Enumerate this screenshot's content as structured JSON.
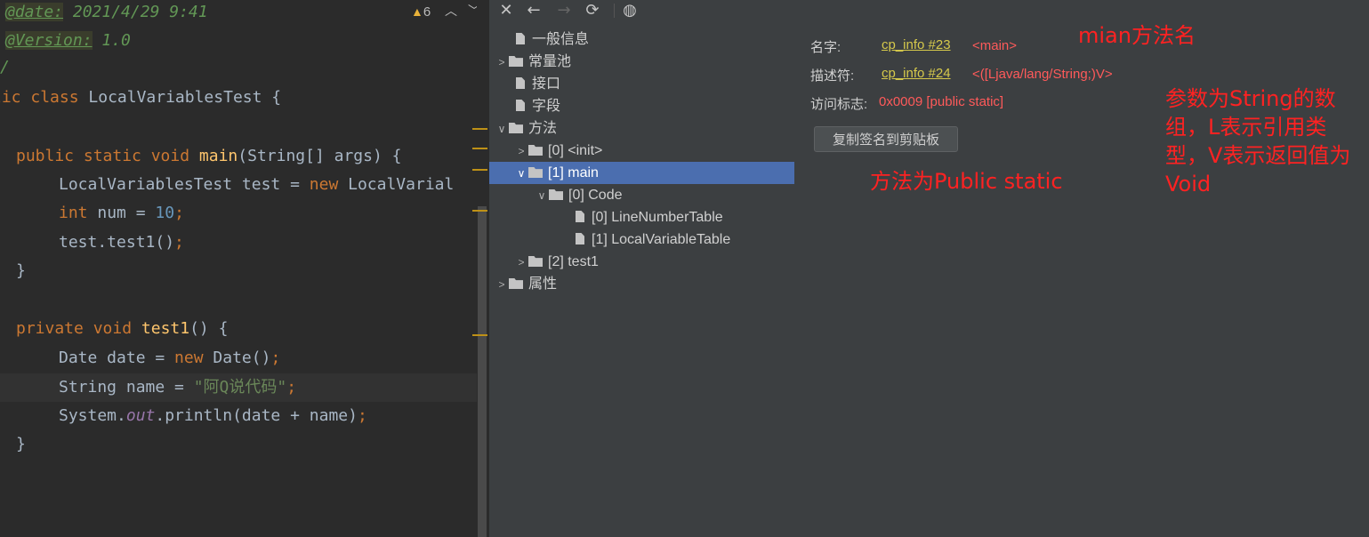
{
  "editor": {
    "warnings": {
      "icon": "warning-icon",
      "count": "6"
    },
    "lines": {
      "l1": {
        "tag": "@date:",
        "rest": " 2021/4/29 9:41"
      },
      "l2": {
        "tag": "@Version:",
        "rest": " 1.0"
      },
      "l3": {
        "text": "/"
      },
      "l4": {
        "kw1": "lic ",
        "kw2": "class ",
        "name": "LocalVariablesTest {"
      },
      "l5": {
        "kw1": "public ",
        "kw2": "static ",
        "kw3": "void ",
        "fn": "main",
        "rest": "(String[] args) {"
      },
      "l6": {
        "a": "LocalVariablesTest test = ",
        "kw": "new ",
        "b": "LocalVarial"
      },
      "l7": {
        "kw": "int ",
        "a": "num = ",
        "num": "10",
        "semi": ";"
      },
      "l8": {
        "a": "test.test1()",
        "semi": ";"
      },
      "l9": {
        "a": "}"
      },
      "l10": {
        "kw1": "private ",
        "kw2": "void ",
        "fn": "test1",
        "rest": "() {"
      },
      "l11": {
        "a": "Date date = ",
        "kw": "new ",
        "b": "Date()",
        "semi": ";"
      },
      "l12": {
        "a": "String name = ",
        "str": "\"阿Q说代码\"",
        "semi": ";"
      },
      "l13": {
        "a": "System.",
        "field": "out",
        "b": ".println(date + name)",
        "semi": ";"
      },
      "l14": {
        "a": "}"
      }
    }
  },
  "toolbar": {
    "close": "✕",
    "back": "←",
    "forward": "→",
    "refresh": "⟳",
    "web": "◍"
  },
  "tree": {
    "general": "一般信息",
    "constant_pool": "常量池",
    "interfaces": "接口",
    "fields": "字段",
    "methods": "方法",
    "m0": "[0] <init>",
    "m1": "[1] main",
    "code": "[0] Code",
    "lnt": "[0] LineNumberTable",
    "lvt": "[1] LocalVariableTable",
    "m2": "[2] test1",
    "attributes": "属性"
  },
  "details": {
    "name_label": "名字:",
    "name_link": "cp_info #23",
    "name_value": "<main>",
    "desc_label": "描述符:",
    "desc_link": "cp_info #24",
    "desc_value": "<([Ljava/lang/String;)V>",
    "access_label": "访问标志:",
    "access_value": "0x0009 [public static]",
    "copy_button": "复制签名到剪贴板"
  },
  "annotations": {
    "a1": "mian方法名",
    "a2": "方法为Public static",
    "a3_l1": "参数为String的数",
    "a3_l2": "组，L表示引用类",
    "a3_l3": "型，V表示返回值为",
    "a3_l4": "Void"
  },
  "colors": {
    "selection": "#4b6eaf",
    "annotation": "#ff2222",
    "link": "#d6c94b"
  }
}
